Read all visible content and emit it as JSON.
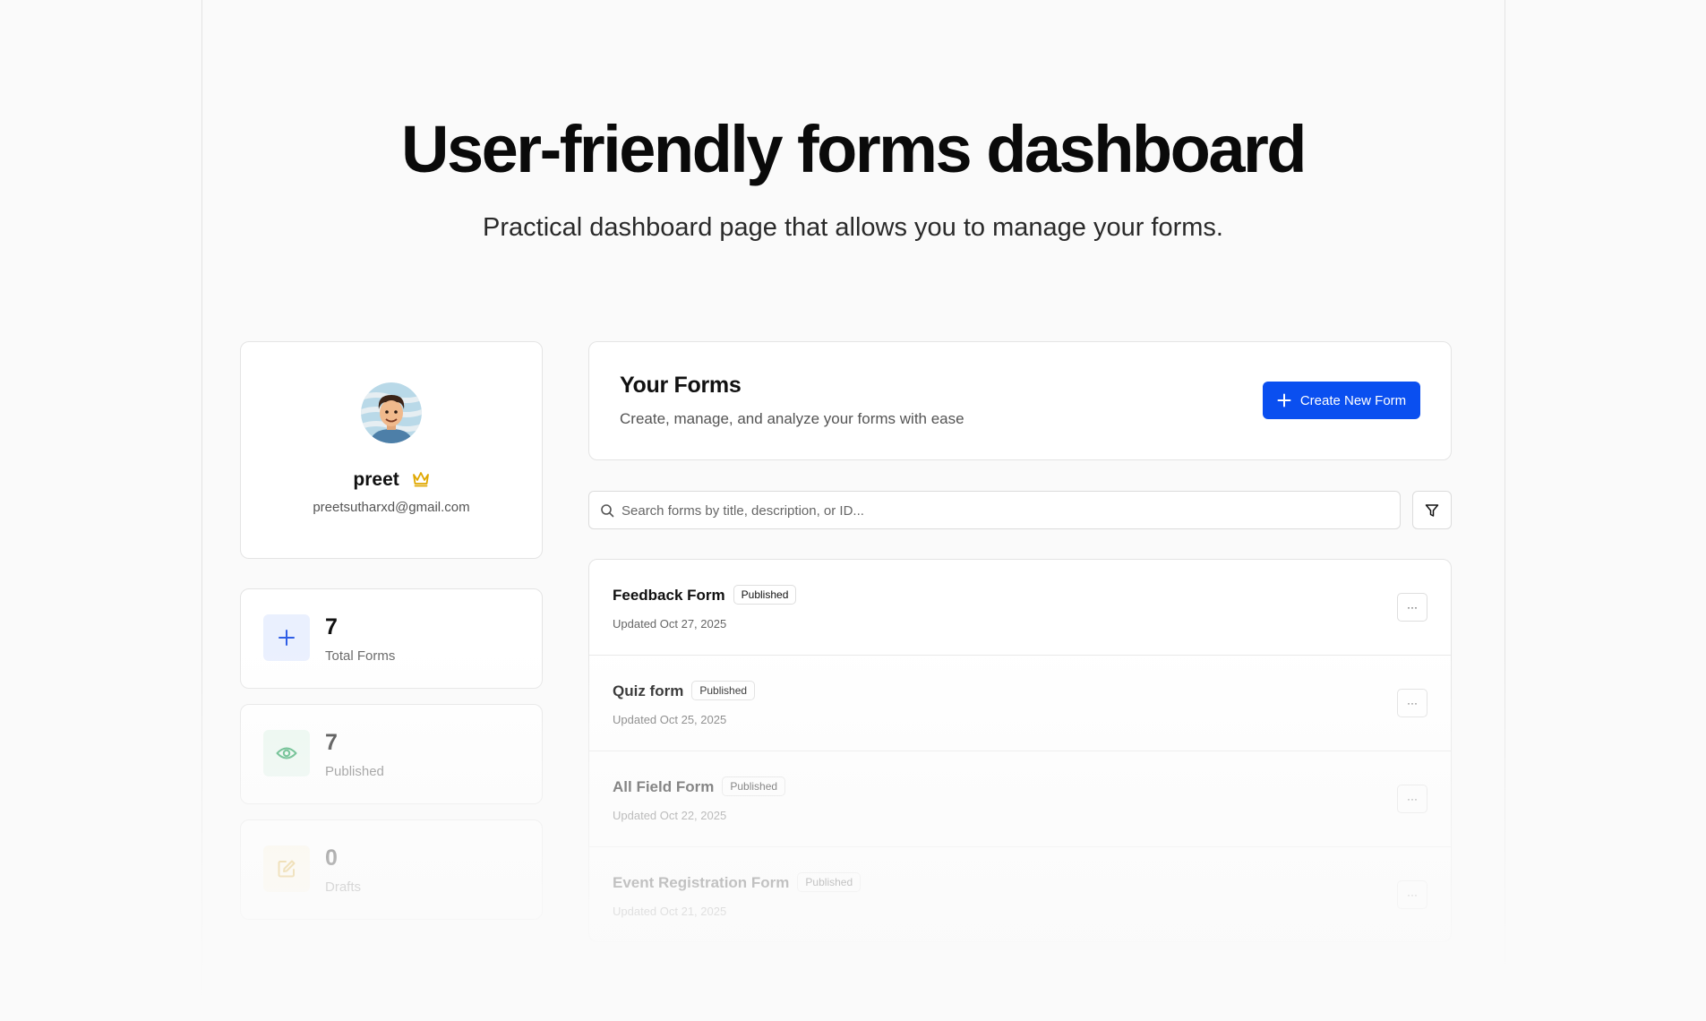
{
  "hero": {
    "title": "User-friendly forms dashboard",
    "subtitle": "Practical dashboard page that allows you to manage your forms."
  },
  "profile": {
    "name": "preet",
    "email": "preetsutharxd@gmail.com",
    "avatar_icon": "avatar-illustration",
    "badge_icon": "crown-icon"
  },
  "stats": [
    {
      "value": "7",
      "label": "Total Forms",
      "icon": "plus-icon",
      "color": "#2f5ee6",
      "bg": "#eaf0fe"
    },
    {
      "value": "7",
      "label": "Published",
      "icon": "eye-icon",
      "color": "#22a05a",
      "bg": "#e8f7ee"
    },
    {
      "value": "0",
      "label": "Drafts",
      "icon": "edit-icon",
      "color": "#d6a21e",
      "bg": "#fdf6e3"
    }
  ],
  "forms_header": {
    "title": "Your Forms",
    "description": "Create, manage, and analyze your forms with ease",
    "create_label": "Create New Form"
  },
  "search": {
    "placeholder": "Search forms by title, description, or ID...",
    "value": ""
  },
  "forms": [
    {
      "name": "Feedback Form",
      "status": "Published",
      "updated": "Updated Oct 27, 2025",
      "menu": "···"
    },
    {
      "name": "Quiz form",
      "status": "Published",
      "updated": "Updated Oct 25, 2025",
      "menu": "···"
    },
    {
      "name": "All Field Form",
      "status": "Published",
      "updated": "Updated Oct 22, 2025",
      "menu": "···"
    },
    {
      "name": "Event Registration Form",
      "status": "Published",
      "updated": "Updated Oct 21, 2025",
      "menu": "···"
    }
  ],
  "colors": {
    "accent": "#0a4ff0",
    "crown": "#e0a800"
  }
}
